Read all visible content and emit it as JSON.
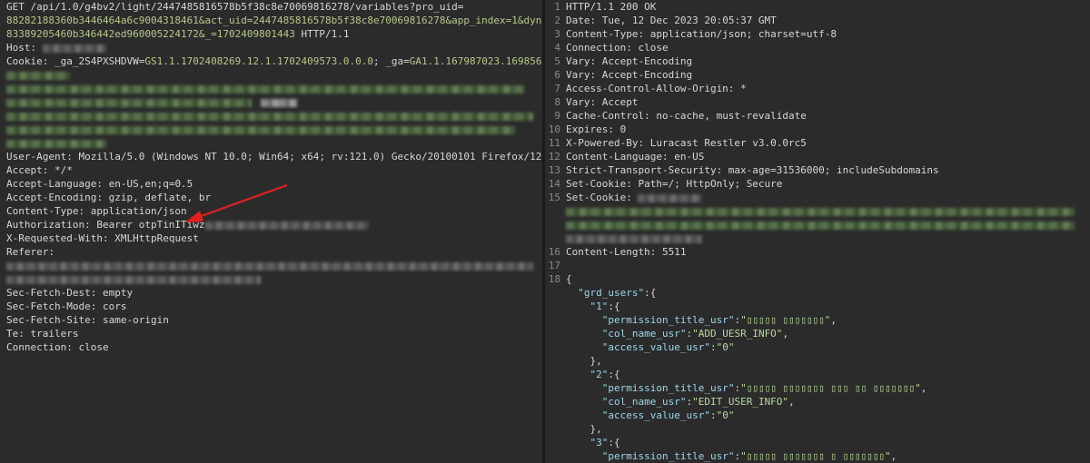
{
  "request": {
    "line1": "GET /api/1.0/g4bv2/light/2447485816578b5f38c8e70069816278/variables?pro_uid=",
    "line2_a": "88282188360b3446464a6c9004318461&act_uid=2447485816578b5f38c8e70069816278&app_index=1&dyn_u",
    "line3_a": "83389205460b346442ed960005224172&_=1702409801443",
    "line3_b": " HTTP/1.1",
    "host_key": "Host:",
    "cookie_key": "Cookie:",
    "cookie_val_a": " _ga_2S4PXSHDVW=",
    "cookie_val_b": "GS1.1.1702408269.12.1.1702409573.0.0.0",
    "cookie_val_c": "; _ga=",
    "cookie_val_d": "GA1.1.167987023.16985695",
    "headers": [
      {
        "key": "User-Agent:",
        "value": " Mozilla/5.0 (Windows NT 10.0; Win64; x64; rv:121.0) Gecko/20100101 Firefox/121.0"
      },
      {
        "key": "Accept:",
        "value": " */*"
      },
      {
        "key": "Accept-Language:",
        "value": " en-US,en;q=0.5"
      },
      {
        "key": "Accept-Encoding:",
        "value": " gzip, deflate, br"
      },
      {
        "key": "Content-Type:",
        "value": " application/json"
      }
    ],
    "auth_key": "Authorization:",
    "auth_val": " Bearer otpTinITiwz",
    "xrw_key": "X-Requested-With:",
    "xrw_val": " XMLHttpRequest",
    "referer_key": "Referer:",
    "headers2": [
      {
        "key": "Sec-Fetch-Dest:",
        "value": " empty"
      },
      {
        "key": "Sec-Fetch-Mode:",
        "value": " cors"
      },
      {
        "key": "Sec-Fetch-Site:",
        "value": " same-origin"
      },
      {
        "key": "Te:",
        "value": " trailers"
      },
      {
        "key": "Connection:",
        "value": " close"
      }
    ]
  },
  "response": {
    "lines": [
      {
        "n": "1",
        "key": "HTTP/1.1 200 OK",
        "value": ""
      },
      {
        "n": "2",
        "key": "Date:",
        "value": " Tue, 12 Dec 2023 20:05:37 GMT"
      },
      {
        "n": "3",
        "key": "Content-Type:",
        "value": " application/json; charset=utf-8"
      },
      {
        "n": "4",
        "key": "Connection:",
        "value": " close"
      },
      {
        "n": "5",
        "key": "Vary:",
        "value": " Accept-Encoding"
      },
      {
        "n": "6",
        "key": "Vary:",
        "value": " Accept-Encoding"
      },
      {
        "n": "7",
        "key": "Access-Control-Allow-Origin:",
        "value": " *"
      },
      {
        "n": "8",
        "key": "Vary:",
        "value": " Accept"
      },
      {
        "n": "9",
        "key": "Cache-Control:",
        "value": " no-cache, must-revalidate"
      },
      {
        "n": "10",
        "key": "Expires:",
        "value": " 0"
      },
      {
        "n": "11",
        "key": "X-Powered-By:",
        "value": " Luracast Restler v3.0.0rc5"
      },
      {
        "n": "12",
        "key": "Content-Language:",
        "value": " en-US"
      },
      {
        "n": "13",
        "key": "Strict-Transport-Security:",
        "value": " max-age=31536000; includeSubdomains"
      },
      {
        "n": "14",
        "key": "Set-Cookie:",
        "value": " Path=/; HttpOnly; Secure"
      }
    ],
    "set_cookie_n": "15",
    "set_cookie_key": "Set-Cookie:",
    "content_length_n": "16",
    "content_length_key": "Content-Length:",
    "content_length_val": " 5511",
    "blank_n": "17",
    "brace_n": "18",
    "open_brace": "{",
    "json": {
      "grd_users_key": "\"grd_users\"",
      "colon_brace": ":{",
      "entries": [
        {
          "id": "\"1\"",
          "perm_key": "\"permission_title_usr\"",
          "perm_val": "\"▯▯▯▯▯ ▯▯▯▯▯▯▯\"",
          "col_key": "\"col_name_usr\"",
          "col_val": "\"ADD_UESR_INFO\"",
          "acc_key": "\"access_value_usr\"",
          "acc_val": "\"0\""
        },
        {
          "id": "\"2\"",
          "perm_key": "\"permission_title_usr\"",
          "perm_val": "\"▯▯▯▯▯ ▯▯▯▯▯▯▯ ▯▯▯ ▯▯ ▯▯▯▯▯▯▯\"",
          "col_key": "\"col_name_usr\"",
          "col_val": "\"EDIT_USER_INFO\"",
          "acc_key": "\"access_value_usr\"",
          "acc_val": "\"0\""
        },
        {
          "id": "\"3\"",
          "perm_key": "\"permission_title_usr\"",
          "perm_val": "\"▯▯▯▯▯ ▯▯▯▯▯▯▯ ▯ ▯▯▯▯▯▯▯\""
        }
      ]
    }
  },
  "colors": {
    "background": "#2b2b2b",
    "arrow": "#e02020"
  }
}
